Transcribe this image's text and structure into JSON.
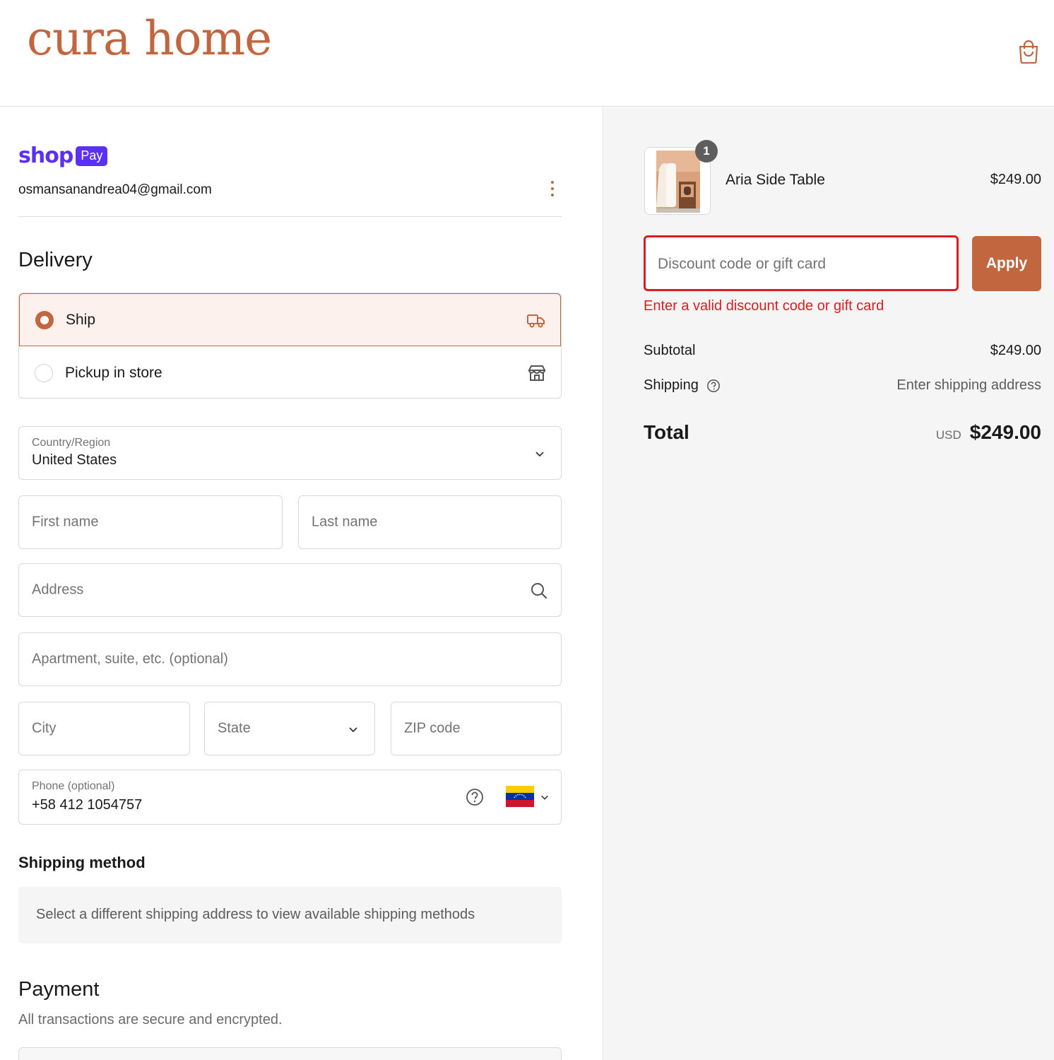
{
  "brand": {
    "logo_text": "cura home",
    "accent_color": "#c2663f"
  },
  "header": {
    "cart_icon": "shopping-bag-icon"
  },
  "account": {
    "shop_label": "shop",
    "pay_label": "Pay",
    "email": "osmansanandrea04@gmail.com",
    "menu_icon": "kebab-menu-icon"
  },
  "delivery": {
    "title": "Delivery",
    "options": [
      {
        "label": "Ship",
        "selected": true,
        "icon": "truck-icon"
      },
      {
        "label": "Pickup in store",
        "selected": false,
        "icon": "store-icon"
      }
    ]
  },
  "form": {
    "country": {
      "label": "Country/Region",
      "value": "United States"
    },
    "first_name": {
      "placeholder": "First name"
    },
    "last_name": {
      "placeholder": "Last name"
    },
    "address": {
      "placeholder": "Address"
    },
    "apartment": {
      "placeholder": "Apartment, suite, etc. (optional)"
    },
    "city": {
      "placeholder": "City"
    },
    "state": {
      "placeholder": "State"
    },
    "zip": {
      "placeholder": "ZIP code"
    },
    "phone": {
      "label": "Phone (optional)",
      "value": "+58 412 1054757",
      "flag": "venezuela-flag-icon"
    }
  },
  "shipping_method": {
    "title": "Shipping method",
    "note": "Select a different shipping address to view available shipping methods"
  },
  "payment": {
    "title": "Payment",
    "subtitle": "All transactions are secure and encrypted."
  },
  "summary": {
    "item": {
      "name": "Aria Side Table",
      "price": "$249.00",
      "quantity": "1"
    },
    "discount": {
      "placeholder": "Discount code or gift card",
      "apply_label": "Apply",
      "error": "Enter a valid discount code or gift card",
      "error_color": "#dd1d1d"
    },
    "subtotal_label": "Subtotal",
    "subtotal_value": "$249.00",
    "shipping_label": "Shipping",
    "shipping_value": "Enter shipping address",
    "total_label": "Total",
    "currency": "USD",
    "total_value": "$249.00"
  }
}
